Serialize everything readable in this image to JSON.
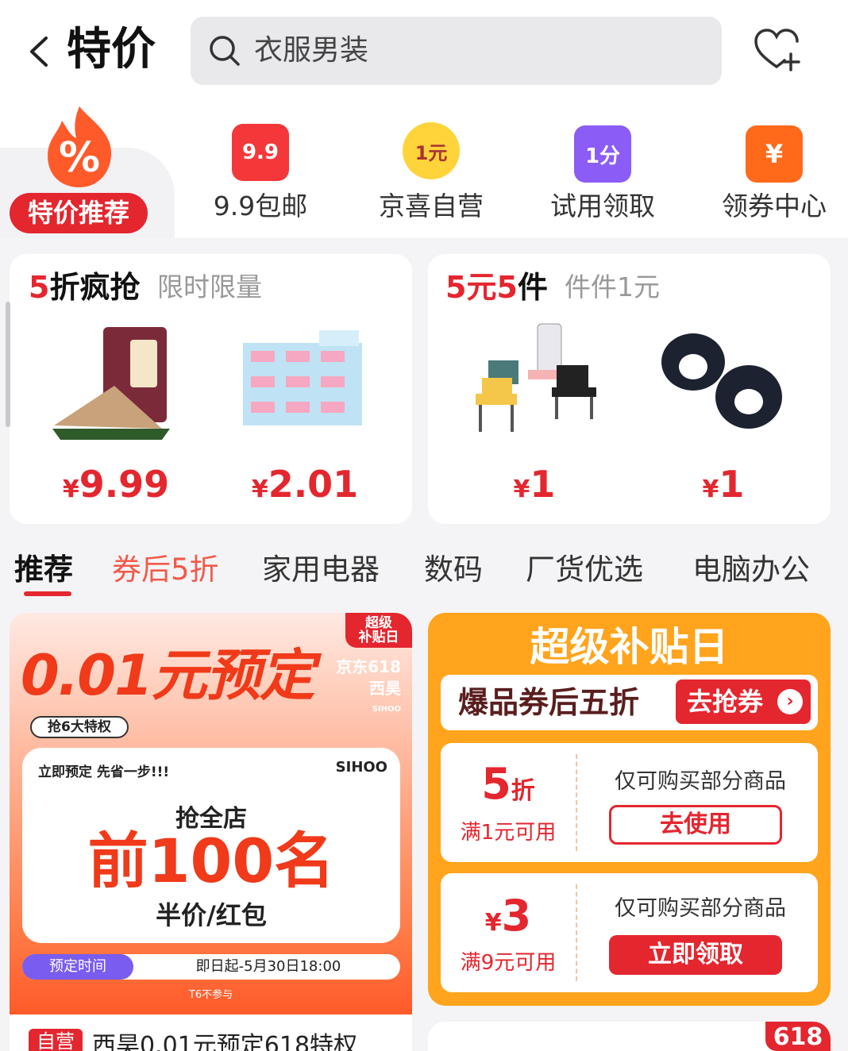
{
  "header": {
    "title": "特价",
    "search_placeholder": "衣服男装"
  },
  "categories": [
    {
      "label": "特价推荐",
      "icon": "percent-fire-icon",
      "active": true
    },
    {
      "label": "9.9包邮",
      "icon": "gift-box-icon",
      "badge": "9.9"
    },
    {
      "label": "京喜自营",
      "icon": "one-yuan-badge-icon",
      "badge": "1元"
    },
    {
      "label": "试用领取",
      "icon": "shopping-bag-icon",
      "badge": "1分"
    },
    {
      "label": "领券中心",
      "icon": "coupon-ticket-icon",
      "badge": "¥"
    }
  ],
  "deals": [
    {
      "title_red": "5",
      "title_black": "折疯抢",
      "subtitle": "限时限量",
      "items": [
        {
          "price_sym": "¥",
          "price": "9.99",
          "icon": "zongzi-product-icon"
        },
        {
          "price_sym": "¥",
          "price": "2.01",
          "icon": "tissue-pack-product-icon"
        }
      ]
    },
    {
      "title_red": "5元5",
      "title_black": "件",
      "subtitle": "件件1元",
      "items": [
        {
          "price_sym": "¥",
          "price": "1",
          "icon": "phone-stand-chairs-product-icon"
        },
        {
          "price_sym": "¥",
          "price": "1",
          "icon": "hair-claw-clip-product-icon"
        }
      ]
    }
  ],
  "tabs": [
    "推荐",
    "券后5折",
    "家用电器",
    "数码",
    "厂货优选",
    "电脑办公"
  ],
  "promo": {
    "badge": "超级\n补贴日",
    "big": "0.01元预定",
    "brand1": "京东618",
    "brand2": "西昊",
    "brand2_en": "SIHOO",
    "pill": "抢6大特权",
    "ticket_top": "立即预定 先省一步!!!",
    "ticket_brand": "SIHOO",
    "ticket_line1": "抢全店",
    "ticket_big": "前100名",
    "ticket_line3": "半价/红包",
    "time_label": "预定时间",
    "time_value": "即日起-5月30日18:00",
    "footnote": "T6不参与",
    "product_tag": "自营",
    "product_name": "西昊0.01元预定618特权"
  },
  "subsidy": {
    "title": "超级补贴日",
    "banner": "爆品券后五折",
    "banner_btn": "去抢券",
    "coupons": [
      {
        "value": "5",
        "unit": "折",
        "cond": "满1元可用",
        "desc": "仅可购买部分商品",
        "btn": "去使用",
        "style": "outline"
      },
      {
        "value": "3",
        "unit": "¥",
        "cond": "满9元可用",
        "desc": "仅可购买部分商品",
        "btn": "立即领取",
        "style": "fill"
      }
    ]
  },
  "next_card_badge": "618",
  "colors": {
    "accent": "#e4262f",
    "orange": "#ffa41c"
  }
}
